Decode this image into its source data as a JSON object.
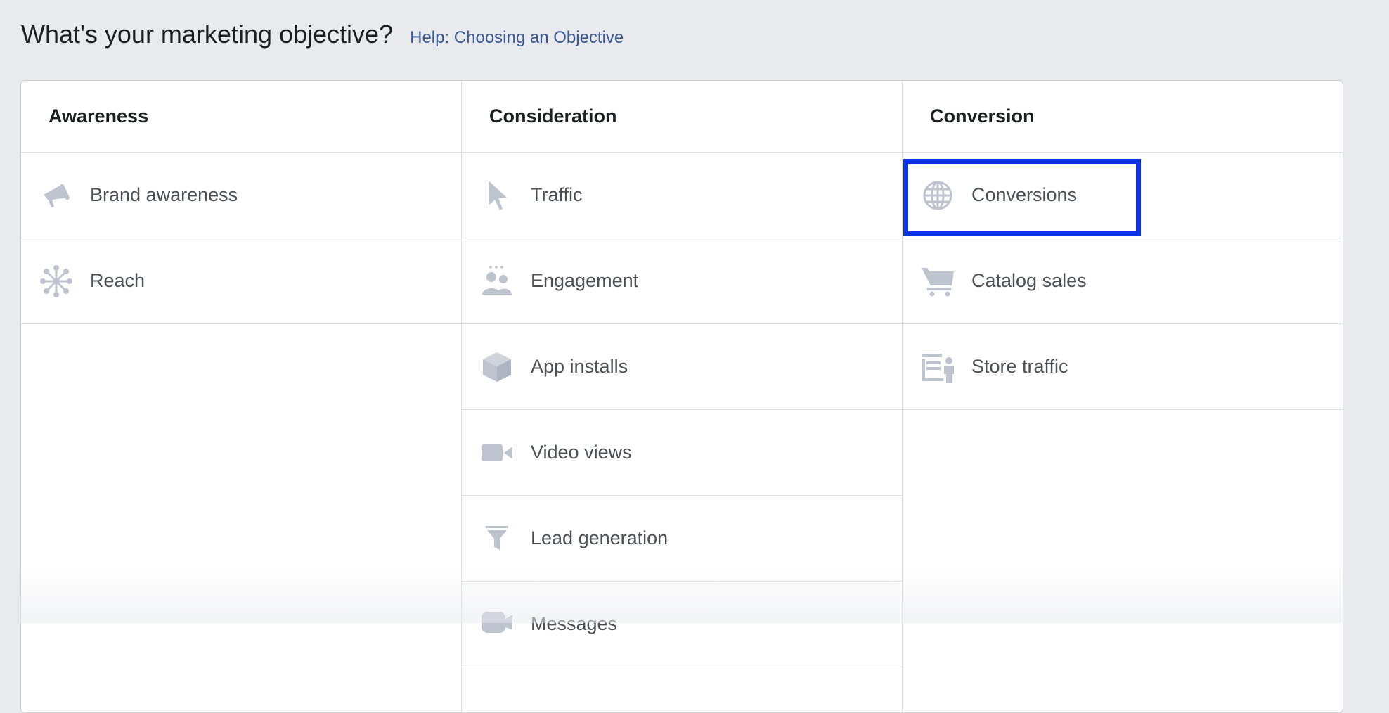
{
  "header": {
    "title": "What's your marketing objective?",
    "help_link": "Help: Choosing an Objective"
  },
  "columns": [
    {
      "heading": "Awareness",
      "items": [
        {
          "label": "Brand awareness",
          "icon": "megaphone-icon"
        },
        {
          "label": "Reach",
          "icon": "reach-network-icon"
        }
      ]
    },
    {
      "heading": "Consideration",
      "items": [
        {
          "label": "Traffic",
          "icon": "cursor-icon"
        },
        {
          "label": "Engagement",
          "icon": "people-icon"
        },
        {
          "label": "App installs",
          "icon": "box-icon"
        },
        {
          "label": "Video views",
          "icon": "video-camera-icon"
        },
        {
          "label": "Lead generation",
          "icon": "funnel-icon"
        },
        {
          "label": "Messages",
          "icon": "chat-bubble-icon"
        }
      ]
    },
    {
      "heading": "Conversion",
      "items": [
        {
          "label": "Conversions",
          "icon": "globe-icon",
          "selected": true
        },
        {
          "label": "Catalog sales",
          "icon": "shopping-cart-icon"
        },
        {
          "label": "Store traffic",
          "icon": "storefront-icon"
        }
      ]
    }
  ],
  "colors": {
    "icon": "#bec3d0",
    "selection_border": "#0a34e6",
    "link": "#385898"
  }
}
